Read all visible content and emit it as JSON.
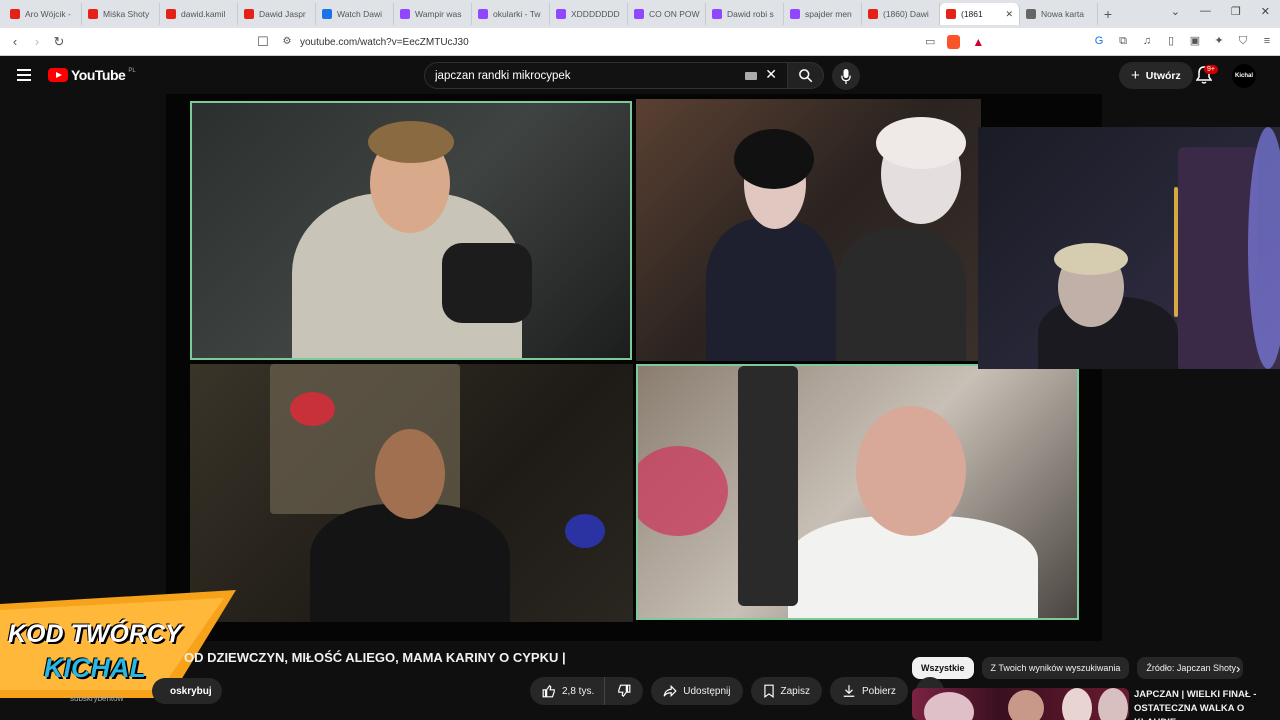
{
  "browser": {
    "tabs": [
      {
        "title": "Aro Wójcik -",
        "color": "#e62117"
      },
      {
        "title": "Miśka Shoty",
        "color": "#e62117"
      },
      {
        "title": "dawid.kamil",
        "color": "#e62117"
      },
      {
        "title": "Dawid Jaspr",
        "color": "#e62117"
      },
      {
        "title": "Watch Dawi",
        "color": "#1a73e8"
      },
      {
        "title": "Wampir was",
        "color": "#9146ff"
      },
      {
        "title": "okularki - Tw",
        "color": "#9146ff"
      },
      {
        "title": "XDDDDDDD",
        "color": "#9146ff"
      },
      {
        "title": "CO ON POW",
        "color": "#9146ff"
      },
      {
        "title": "Dawid robi s",
        "color": "#9146ff"
      },
      {
        "title": "spajder men",
        "color": "#9146ff"
      },
      {
        "title": "(1860) Dawi",
        "color": "#e62117"
      },
      {
        "title": "(1861",
        "color": "#e62117",
        "active": true
      },
      {
        "title": "Nowa karta",
        "color": "#666666"
      }
    ],
    "url": "youtube.com/watch?v=EecZMTUcJ30"
  },
  "header": {
    "logo_text": "YouTube",
    "country_code": "PL",
    "search_value": "japczan randki mikrocypek",
    "create_label": "Utwórz",
    "notif_badge": "9+",
    "avatar_text": "Kichal"
  },
  "promo": {
    "line1": "KOD TWÓRCY",
    "line2": "KICHAL"
  },
  "video": {
    "title": "OD DZIEWCZYN, MIŁOŚĆ ALIEGO, MAMA KARINY O CYPKU |",
    "subscribe_label": "oskrybuj",
    "channel_sub": "subskrybentów",
    "likes": "2,8 tys.",
    "share_label": "Udostępnij",
    "save_label": "Zapisz",
    "download_label": "Pobierz"
  },
  "chips": [
    "Wszystkie",
    "Z Twoich wyników wyszukiwania",
    "Źródło: Japczan Shoty"
  ],
  "recommendation": {
    "title": "JAPCZAN | WIELKI FINAŁ - OSTATECZNA WALKA O KLAUDIĘ"
  },
  "colors": {
    "accent_red": "#ff0000",
    "cam_border": "#7cc99a",
    "promo_orange": "#f7a21b",
    "promo_blue": "#29b8e6"
  }
}
